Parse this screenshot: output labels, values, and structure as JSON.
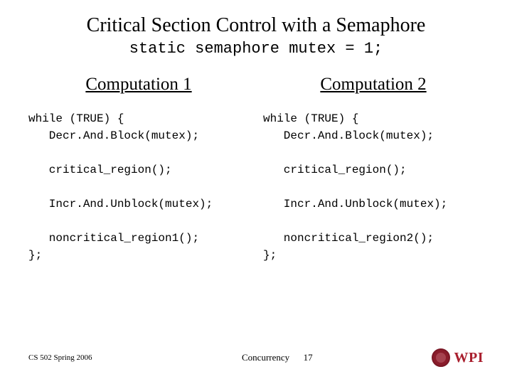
{
  "title": "Critical Section Control with a Semaphore",
  "subtitle": "static semaphore mutex = 1;",
  "columns": [
    {
      "heading": "Computation 1",
      "code": "while (TRUE) {\n   Decr.And.Block(mutex);\n\n   critical_region();\n\n   Incr.And.Unblock(mutex);\n\n   noncritical_region1();\n};"
    },
    {
      "heading": "Computation 2",
      "code": "while (TRUE) {\n   Decr.And.Block(mutex);\n\n   critical_region();\n\n   Incr.And.Unblock(mutex);\n\n   noncritical_region2();\n};"
    }
  ],
  "footer": {
    "left": "CS 502 Spring 2006",
    "center_label": "Concurrency",
    "page_number": "17",
    "logo_text": "WPI"
  }
}
